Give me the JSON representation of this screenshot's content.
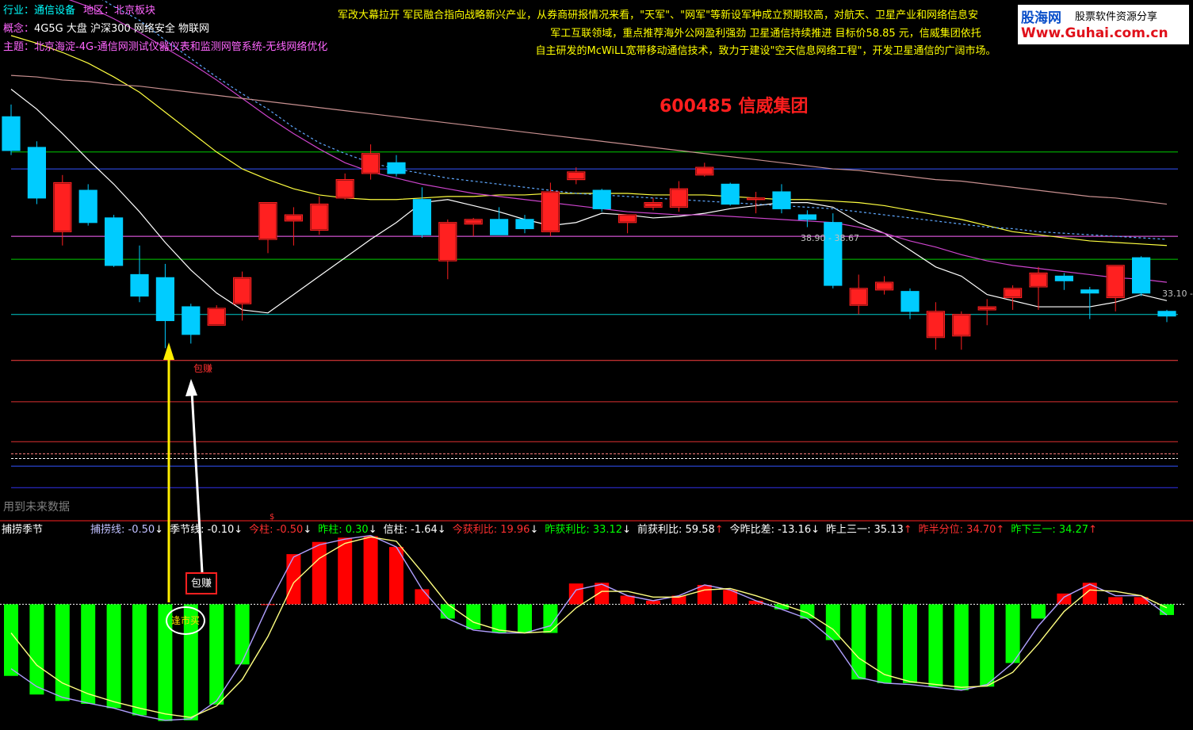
{
  "header": {
    "industry_label": "行业：",
    "industry": "通信设备",
    "region_label": "地区：",
    "region": "北京板块",
    "concept_label": "概念：",
    "concept": "4G5G 大盘 沪深300 网络安全 物联网",
    "theme_label": "主题：",
    "theme": "北京海淀-4G-通信网测试仪器仪表和监测网管系统-无线网络优化"
  },
  "news": {
    "line1": "军改大幕拉开 军民融合指向战略新兴产业，从券商研报情况来看，\"天军\"、\"网军\"等新设军种成立预期较高，对航天、卫星产业和网络信息安",
    "line2": "军工互联领域，重点推荐海外公网盈利强劲 卫星通信持续推进 目标价58.85 元，信威集团依托",
    "line3": "自主研发的McWiLL宽带移动通信技术，致力于建设\"空天信息网络工程\"，开发卫星通信的广阔市场。"
  },
  "logo": {
    "name": "股海网",
    "tagline": "股票软件资源分享",
    "url": "Www.Guhai.com.cn"
  },
  "chart_title": "600485 信威集团",
  "future_note": "用到未来数据",
  "annotations": {
    "price_label": "包赚",
    "sub_badge": "包赚",
    "circle_label": "逢市买",
    "price_tag_1": "38.90 - 38.67",
    "price_tag_2": "33.10 -"
  },
  "sub_panel": {
    "name": "捕捞季节",
    "readouts": [
      {
        "label": "捕捞线:",
        "value": "-0.50",
        "arrow": "↓",
        "color": "#c0c0ff"
      },
      {
        "label": "季节线:",
        "value": "-0.10",
        "arrow": "↓",
        "color": "#ffffff"
      },
      {
        "label": "今柱:",
        "value": "-0.50",
        "arrow": "↓",
        "color": "#ff3030"
      },
      {
        "label": "昨柱:",
        "value": "0.30",
        "arrow": "↓",
        "color": "#00ff00"
      },
      {
        "label": "信柱:",
        "value": "-1.64",
        "arrow": "↓",
        "color": "#ffffff"
      },
      {
        "label": "今获利比:",
        "value": "19.96",
        "arrow": "↓",
        "color": "#ff3030"
      },
      {
        "label": "昨获利比:",
        "value": "33.12",
        "arrow": "↓",
        "color": "#00ff00"
      },
      {
        "label": "前获利比:",
        "value": "59.58",
        "arrow": "↑",
        "color": "#ffffff"
      },
      {
        "label": "今昨比差:",
        "value": "-13.16",
        "arrow": "↓",
        "color": "#ffffff"
      },
      {
        "label": "昨上三一:",
        "value": "35.13",
        "arrow": "↑",
        "color": "#ffffff"
      },
      {
        "label": "昨半分位:",
        "value": "34.70",
        "arrow": "↑",
        "color": "#ff3030"
      },
      {
        "label": "昨下三一:",
        "value": "34.27",
        "arrow": "↑",
        "color": "#00ff00"
      }
    ]
  },
  "colors": {
    "up": "#ff2020",
    "down": "#00ccff",
    "hist_pos": "#ff0000",
    "hist_neg": "#00ff00"
  },
  "chart_data": {
    "type": "candlestick",
    "title": "600485 信威集团",
    "ylim": [
      24,
      54
    ],
    "candles": [
      {
        "o": 50.0,
        "h": 50.8,
        "c": 47.8,
        "l": 47.5
      },
      {
        "o": 48.0,
        "h": 48.4,
        "c": 44.7,
        "l": 44.3
      },
      {
        "o": 42.5,
        "h": 46.2,
        "c": 45.7,
        "l": 41.6
      },
      {
        "o": 45.2,
        "h": 45.6,
        "c": 43.1,
        "l": 42.9
      },
      {
        "o": 43.4,
        "h": 43.6,
        "c": 40.3,
        "l": 40.2
      },
      {
        "o": 39.7,
        "h": 41.6,
        "c": 38.3,
        "l": 37.9
      },
      {
        "o": 39.5,
        "h": 40.4,
        "c": 36.7,
        "l": 34.9
      },
      {
        "o": 37.6,
        "h": 37.8,
        "c": 35.8,
        "l": 35.2
      },
      {
        "o": 36.4,
        "h": 37.7,
        "c": 37.5,
        "l": 36.4
      },
      {
        "o": 37.8,
        "h": 39.9,
        "c": 39.5,
        "l": 36.7
      },
      {
        "o": 42.0,
        "h": 42.2,
        "c": 44.4,
        "l": 41.1
      },
      {
        "o": 43.2,
        "h": 44.1,
        "c": 43.6,
        "l": 41.6
      },
      {
        "o": 42.6,
        "h": 44.8,
        "c": 44.3,
        "l": 42.3
      },
      {
        "o": 44.7,
        "h": 46.3,
        "c": 45.9,
        "l": 44.6
      },
      {
        "o": 46.3,
        "h": 48.2,
        "c": 47.6,
        "l": 45.9
      },
      {
        "o": 47.0,
        "h": 47.5,
        "c": 46.3,
        "l": 46.1
      },
      {
        "o": 44.6,
        "h": 45.4,
        "c": 42.3,
        "l": 42.1
      },
      {
        "o": 40.6,
        "h": 43.3,
        "c": 43.1,
        "l": 39.4
      },
      {
        "o": 43.0,
        "h": 43.4,
        "c": 43.3,
        "l": 42.2
      },
      {
        "o": 43.3,
        "h": 44.1,
        "c": 42.3,
        "l": 42.3
      },
      {
        "o": 43.3,
        "h": 43.6,
        "c": 42.7,
        "l": 42.4
      },
      {
        "o": 42.5,
        "h": 45.7,
        "c": 45.1,
        "l": 42.2
      },
      {
        "o": 45.9,
        "h": 46.7,
        "c": 46.4,
        "l": 45.6
      },
      {
        "o": 45.2,
        "h": 45.3,
        "c": 44.0,
        "l": 43.8
      },
      {
        "o": 43.1,
        "h": 43.6,
        "c": 43.6,
        "l": 42.4
      },
      {
        "o": 44.1,
        "h": 44.7,
        "c": 44.4,
        "l": 43.9
      },
      {
        "o": 44.1,
        "h": 45.8,
        "c": 45.3,
        "l": 43.8
      },
      {
        "o": 46.2,
        "h": 47.0,
        "c": 46.7,
        "l": 46.1
      },
      {
        "o": 45.6,
        "h": 45.7,
        "c": 44.3,
        "l": 44.2
      },
      {
        "o": 44.7,
        "h": 45.1,
        "c": 44.7,
        "l": 43.7
      },
      {
        "o": 45.1,
        "h": 45.6,
        "c": 44.0,
        "l": 43.7
      },
      {
        "o": 43.6,
        "h": 43.9,
        "c": 43.3,
        "l": 42.8
      },
      {
        "o": 43.1,
        "h": 43.7,
        "c": 39.0,
        "l": 38.8
      },
      {
        "o": 37.7,
        "h": 39.7,
        "c": 38.8,
        "l": 37.1
      },
      {
        "o": 38.7,
        "h": 39.6,
        "c": 39.2,
        "l": 38.4
      },
      {
        "o": 38.6,
        "h": 38.8,
        "c": 37.3,
        "l": 36.8
      },
      {
        "o": 35.6,
        "h": 37.9,
        "c": 37.3,
        "l": 34.8
      },
      {
        "o": 35.7,
        "h": 37.3,
        "c": 37.1,
        "l": 34.8
      },
      {
        "o": 37.4,
        "h": 38.1,
        "c": 37.6,
        "l": 36.4
      },
      {
        "o": 38.2,
        "h": 39.0,
        "c": 38.8,
        "l": 37.4
      },
      {
        "o": 38.9,
        "h": 40.2,
        "c": 39.8,
        "l": 37.4
      },
      {
        "o": 39.6,
        "h": 39.8,
        "c": 39.3,
        "l": 38.7
      },
      {
        "o": 38.7,
        "h": 38.9,
        "c": 38.5,
        "l": 36.8
      },
      {
        "o": 38.2,
        "h": 40.3,
        "c": 40.3,
        "l": 37.3
      },
      {
        "o": 40.8,
        "h": 40.9,
        "c": 38.5,
        "l": 38.3
      },
      {
        "o": 37.3,
        "h": 37.4,
        "c": 37.0,
        "l": 36.6
      }
    ],
    "hlines": [
      {
        "y": 47.7,
        "color": "#00cc00"
      },
      {
        "y": 46.6,
        "color": "#3355ff"
      },
      {
        "y": 42.2,
        "color": "#ff66ff"
      },
      {
        "y": 40.7,
        "color": "#00cc00"
      },
      {
        "y": 37.1,
        "color": "#00cccc"
      },
      {
        "y": 34.1,
        "color": "#ff4040"
      },
      {
        "y": 31.4,
        "color": "#dd3030"
      },
      {
        "y": 28.8,
        "color": "#dd3030"
      },
      {
        "y": 28.0,
        "color": "#ff8080",
        "dash": true
      },
      {
        "y": 27.7,
        "color": "#ffffff",
        "dash": true
      },
      {
        "y": 27.2,
        "color": "#3355ff"
      },
      {
        "y": 25.8,
        "color": "#3333ee"
      }
    ],
    "ma_lines": [
      {
        "color": "#ffffff",
        "values": [
          51.8,
          50.5,
          48.9,
          47.2,
          45.6,
          43.8,
          41.8,
          40.0,
          38.5,
          37.4,
          37.2,
          38.4,
          39.6,
          40.8,
          42.0,
          43.1,
          44.4,
          44.6,
          44.2,
          43.8,
          43.3,
          42.9,
          43.1,
          43.7,
          43.6,
          43.4,
          43.5,
          43.7,
          44.0,
          44.2,
          44.4,
          44.4,
          44.1,
          43.1,
          42.4,
          41.3,
          40.2,
          39.6,
          38.4,
          38.0,
          37.6,
          37.6,
          37.6,
          37.9,
          38.4,
          38.0
        ]
      },
      {
        "color": "#ffff40",
        "values": [
          55.3,
          54.8,
          54.2,
          53.5,
          52.6,
          51.6,
          50.3,
          49.0,
          47.7,
          46.6,
          45.9,
          45.3,
          44.9,
          44.7,
          44.6,
          44.6,
          44.7,
          44.8,
          44.8,
          44.9,
          44.9,
          45.0,
          45.0,
          45.0,
          45.0,
          44.9,
          44.9,
          44.9,
          44.8,
          44.7,
          44.6,
          44.6,
          44.5,
          44.4,
          44.2,
          43.9,
          43.6,
          43.3,
          42.9,
          42.5,
          42.3,
          42.1,
          41.9,
          41.8,
          41.7,
          41.6
        ]
      },
      {
        "color": "#cc44cc",
        "values": [
          58.8,
          58.4,
          57.8,
          57.2,
          56.4,
          55.5,
          54.5,
          53.5,
          52.4,
          51.2,
          50.0,
          48.9,
          47.9,
          47.0,
          46.4,
          46.0,
          45.6,
          45.3,
          45.0,
          44.8,
          44.6,
          44.4,
          44.2,
          44.0,
          43.8,
          43.7,
          43.6,
          43.6,
          43.5,
          43.4,
          43.3,
          43.2,
          43.1,
          42.8,
          42.4,
          41.9,
          41.5,
          41.0,
          40.6,
          40.3,
          40.1,
          39.9,
          39.7,
          39.5,
          39.4,
          39.2
        ]
      },
      {
        "color": "#5fa8ff",
        "dash": true,
        "values": [
          60.5,
          59.8,
          59.0,
          58.2,
          57.2,
          56.3,
          55.0,
          53.8,
          52.6,
          51.5,
          50.5,
          49.3,
          48.3,
          47.6,
          47.0,
          46.6,
          46.3,
          46.0,
          45.8,
          45.6,
          45.4,
          45.2,
          45.0,
          44.9,
          44.8,
          44.7,
          44.6,
          44.5,
          44.4,
          44.3,
          44.2,
          44.1,
          44.0,
          43.8,
          43.6,
          43.4,
          43.2,
          43.0,
          42.8,
          42.7,
          42.5,
          42.4,
          42.3,
          42.2,
          42.1,
          42.0
        ]
      },
      {
        "color": "#c89090",
        "values": [
          52.7,
          52.6,
          52.4,
          52.3,
          52.1,
          52.0,
          51.8,
          51.6,
          51.4,
          51.2,
          51.0,
          50.8,
          50.6,
          50.4,
          50.2,
          50.0,
          49.8,
          49.6,
          49.4,
          49.2,
          49.0,
          48.8,
          48.6,
          48.4,
          48.2,
          48.0,
          47.8,
          47.6,
          47.4,
          47.2,
          47.0,
          46.8,
          46.6,
          46.5,
          46.3,
          46.1,
          45.9,
          45.8,
          45.6,
          45.4,
          45.2,
          45.0,
          44.8,
          44.7,
          44.5,
          44.3
        ]
      }
    ],
    "indicator": {
      "ylim": [
        -1.7,
        1.0
      ],
      "hist": [
        -1.0,
        -1.26,
        -1.35,
        -1.39,
        -1.45,
        -1.55,
        -1.63,
        -1.62,
        -1.4,
        -0.84,
        0.0,
        0.7,
        0.87,
        0.93,
        0.95,
        0.8,
        0.21,
        -0.2,
        -0.35,
        -0.4,
        -0.4,
        -0.4,
        0.29,
        0.3,
        0.12,
        0.05,
        0.12,
        0.27,
        0.2,
        0.05,
        -0.07,
        -0.2,
        -0.5,
        -1.05,
        -1.1,
        -1.1,
        -1.15,
        -1.2,
        -1.15,
        -0.82,
        -0.2,
        0.15,
        0.3,
        0.1,
        0.1,
        -0.15
      ],
      "line_fast": [
        -0.9,
        -1.15,
        -1.3,
        -1.38,
        -1.45,
        -1.55,
        -1.62,
        -1.6,
        -1.35,
        -0.8,
        -0.02,
        0.66,
        0.83,
        0.91,
        0.96,
        0.8,
        0.21,
        -0.2,
        -0.36,
        -0.4,
        -0.4,
        -0.3,
        0.2,
        0.28,
        0.12,
        0.05,
        0.12,
        0.27,
        0.2,
        0.05,
        -0.07,
        -0.2,
        -0.5,
        -1.02,
        -1.1,
        -1.12,
        -1.16,
        -1.2,
        -1.12,
        -0.82,
        -0.3,
        0.1,
        0.28,
        0.12,
        0.12,
        -0.15
      ],
      "line_slow": [
        -0.4,
        -0.85,
        -1.1,
        -1.25,
        -1.36,
        -1.45,
        -1.53,
        -1.58,
        -1.42,
        -1.05,
        -0.45,
        0.3,
        0.64,
        0.85,
        0.94,
        0.88,
        0.45,
        0.0,
        -0.25,
        -0.36,
        -0.4,
        -0.38,
        -0.05,
        0.18,
        0.18,
        0.1,
        0.1,
        0.2,
        0.22,
        0.12,
        0.0,
        -0.12,
        -0.35,
        -0.75,
        -0.98,
        -1.08,
        -1.12,
        -1.16,
        -1.14,
        -0.95,
        -0.55,
        -0.1,
        0.2,
        0.18,
        0.12,
        -0.05
      ]
    }
  }
}
